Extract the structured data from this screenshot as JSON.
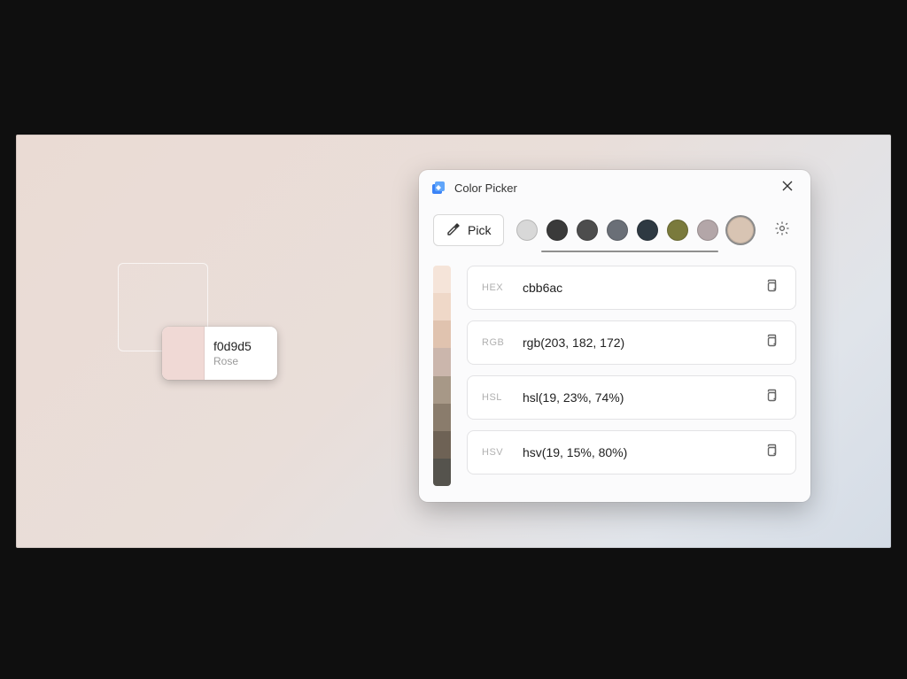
{
  "tooltip": {
    "swatch_color": "#f0d9d5",
    "hex_label": "f0d9d5",
    "name_label": "Rose"
  },
  "picker": {
    "title": "Color Picker",
    "pick_button_label": "Pick",
    "swatches": [
      "#d8d8d8",
      "#3a3a3a",
      "#4d4d4d",
      "#6a6f77",
      "#2e3942",
      "#7a7a3c",
      "#b3a6a8",
      "#d8c4b3"
    ],
    "selected_swatch_index": 7,
    "shades": [
      "#f5e4d9",
      "#efd8c8",
      "#e0c3af",
      "#cbb6ac",
      "#a79887",
      "#8a7c6c",
      "#6e6255",
      "#55534d"
    ],
    "formats": [
      {
        "label": "HEX",
        "value": "cbb6ac"
      },
      {
        "label": "RGB",
        "value": "rgb(203, 182, 172)"
      },
      {
        "label": "HSL",
        "value": "hsl(19, 23%, 74%)"
      },
      {
        "label": "HSV",
        "value": "hsv(19, 15%, 80%)"
      }
    ]
  }
}
